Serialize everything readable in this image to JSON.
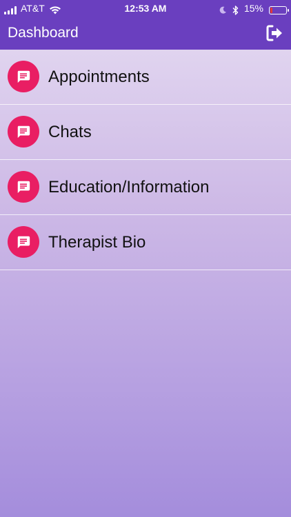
{
  "status_bar": {
    "carrier": "AT&T",
    "time": "12:53 AM",
    "battery": "15%",
    "battery_level": 0.15
  },
  "header": {
    "title": "Dashboard",
    "logout_icon": "logout-icon"
  },
  "menu": {
    "items": [
      {
        "label": "Appointments",
        "icon": "chat-message-icon"
      },
      {
        "label": "Chats",
        "icon": "chat-message-icon"
      },
      {
        "label": "Education/Information",
        "icon": "chat-message-icon"
      },
      {
        "label": "Therapist Bio",
        "icon": "chat-message-icon"
      }
    ]
  },
  "colors": {
    "header_bg": "#6a3fbf",
    "icon_badge": "#e91e63",
    "battery_low": "#e53935"
  }
}
